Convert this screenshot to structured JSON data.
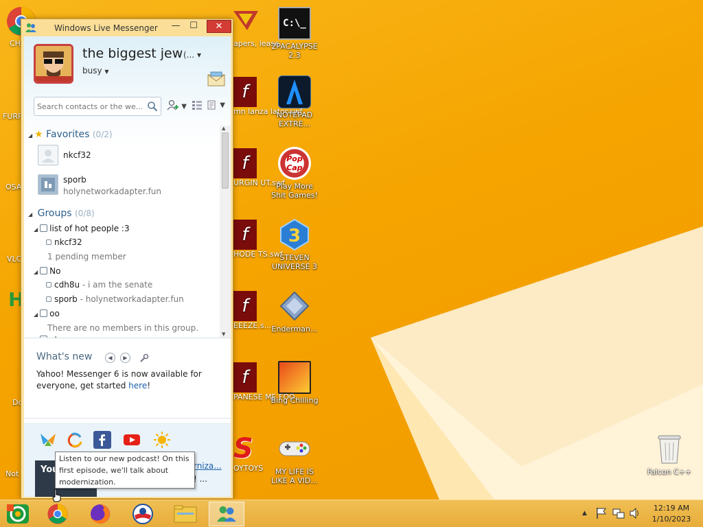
{
  "window": {
    "title": "Windows Live Messenger",
    "minimize": "—",
    "maximize": "☐",
    "close": "✕"
  },
  "profile": {
    "display_name": "the biggest jew",
    "name_more": "(... ▾",
    "status": "busy"
  },
  "search": {
    "placeholder": "Search contacts or the we..."
  },
  "favorites": {
    "label": "Favorites",
    "count": "(0/2)",
    "contacts": [
      {
        "name": "nkcf32",
        "message": ""
      },
      {
        "name": "sporb",
        "message": "holynetworkadapter.fun"
      }
    ]
  },
  "groups": {
    "label": "Groups",
    "count": "(0/8)",
    "list": [
      {
        "name": "list of hot people :3",
        "members": [
          {
            "name": "nkcf32",
            "message": ""
          }
        ],
        "note": "1 pending member"
      },
      {
        "name": "No",
        "members": [
          {
            "name": "cdh8u",
            "message": "i am the senate"
          },
          {
            "name": "sporb",
            "message": "holynetworkadapter.fun"
          }
        ],
        "note": ""
      },
      {
        "name": "oo",
        "members": [],
        "note": "There are no members in this group."
      },
      {
        "name": "atpow",
        "members": [],
        "note": ""
      }
    ]
  },
  "whats_new": {
    "title": "What's new",
    "text": "Yahoo! Messenger 6 is now available for everyone, get started ",
    "link": "here",
    "text_end": "!"
  },
  "ad": {
    "thumb_text": "You G Ta",
    "title": "You've Got Talk: Moderniza...",
    "sub": "st! ...",
    "sub2": "ideo"
  },
  "tooltip": {
    "text": "Listen to our new podcast! On this first episode, we'll talk about modernization."
  },
  "desktop_icons": [
    {
      "label": "2PACALYPSE\n2.3",
      "icon": "cmd-icon"
    },
    {
      "label": "NOTEPAD\nEXTRE...",
      "icon": "notepad-extreme-icon"
    },
    {
      "label": "Play More\nShit Games!",
      "icon": "popcap-icon"
    },
    {
      "label": "STEVEN\nUNIVERSE 3",
      "icon": "steven-universe-icon"
    },
    {
      "label": "Enderman...",
      "icon": "enderman-icon"
    },
    {
      "label": "Bing Chilling",
      "icon": "bing-chilling-icon"
    },
    {
      "label": "MY LIFE IS\nLIKE A VID...",
      "icon": "gamepad-icon"
    },
    {
      "label": "Falcon C++",
      "icon": "recycle-bin-icon"
    }
  ],
  "cropped_labels": [
    "apers,\nlease",
    "mn lanza\nlator.swf",
    "URGIN\nUT.swf",
    "HODE\nTS.swf",
    "EEEZE.s...",
    "PANESE\nME FOO...",
    "OYTOYS",
    "CH\nDi",
    "FURR",
    "OSA\nLAD",
    "VLC\np",
    "Do",
    "Not"
  ],
  "clock": {
    "time": "12:19 AM",
    "date": "1/10/2023"
  },
  "colors": {
    "wallpaper": "#f5a800",
    "close": "#d23c34",
    "link": "#1a5fa8"
  }
}
